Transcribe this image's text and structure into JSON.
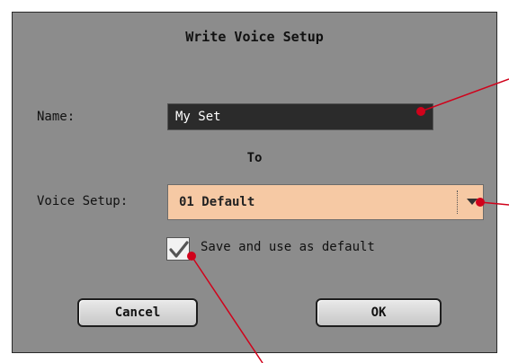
{
  "dialog": {
    "title": "Write Voice Setup",
    "name_label": "Name:",
    "name_value": "My Set",
    "to_label": "To",
    "voice_setup_label": "Voice Setup:",
    "voice_setup_value": "01 Default",
    "checkbox_label": "Save and use as default",
    "checkbox_checked": true,
    "cancel_label": "Cancel",
    "ok_label": "OK"
  },
  "colors": {
    "dialog_bg": "#8c8c8c",
    "field_bg": "#2b2b2b",
    "select_bg": "#f6c9a4",
    "callout": "#d0021b"
  },
  "icons": [
    "dropdown-arrow-icon",
    "checkmark-icon"
  ]
}
